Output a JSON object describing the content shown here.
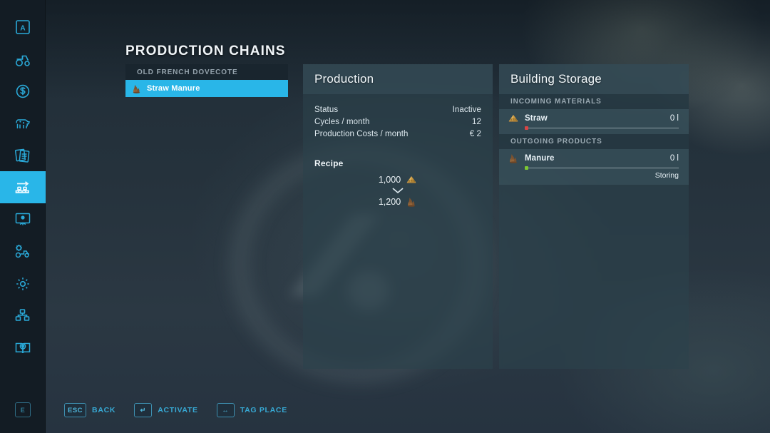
{
  "page": {
    "title": "PRODUCTION CHAINS"
  },
  "theme": {
    "accent": "#29b6e8",
    "panel_bg": "#2c424c",
    "text": "#eaf2f7",
    "muted": "#95a3ad",
    "status_ok": "#7dc832",
    "status_err": "#d94545"
  },
  "sidebar": {
    "items": [
      {
        "icon": "key-a-icon",
        "name": "sidebar-item-key-a",
        "selected": false
      },
      {
        "icon": "tractor-icon",
        "name": "sidebar-item-vehicles",
        "selected": false
      },
      {
        "icon": "finances-icon",
        "name": "sidebar-item-finances",
        "selected": false
      },
      {
        "icon": "animals-icon",
        "name": "sidebar-item-animals",
        "selected": false
      },
      {
        "icon": "contracts-icon",
        "name": "sidebar-item-contracts",
        "selected": false
      },
      {
        "icon": "production-icon",
        "name": "sidebar-item-production-chains",
        "selected": true
      },
      {
        "icon": "ai-worker-icon",
        "name": "sidebar-item-ai-workers",
        "selected": false
      },
      {
        "icon": "construction-icon",
        "name": "sidebar-item-construction",
        "selected": false
      },
      {
        "icon": "gear-icon",
        "name": "sidebar-item-settings",
        "selected": false
      },
      {
        "icon": "map-overview-icon",
        "name": "sidebar-item-map-overview",
        "selected": false
      },
      {
        "icon": "help-book-icon",
        "name": "sidebar-item-help",
        "selected": false
      }
    ],
    "bottom_key": "E"
  },
  "production_list": {
    "group_header": "OLD FRENCH DOVECOTE",
    "items": [
      {
        "label": "Straw Manure",
        "icon": "manure-icon",
        "selected": true
      }
    ]
  },
  "production_panel": {
    "title": "Production",
    "stats": [
      {
        "label": "Status",
        "value": "Inactive"
      },
      {
        "label": "Cycles / month",
        "value": "12"
      },
      {
        "label": "Production Costs / month",
        "value": "€ 2"
      }
    ],
    "recipe": {
      "title": "Recipe",
      "input": {
        "amount": "1,000",
        "icon": "straw-icon"
      },
      "arrow": "⌄",
      "output": {
        "amount": "1,200",
        "icon": "manure-icon"
      }
    }
  },
  "storage_panel": {
    "title": "Building Storage",
    "sections": [
      {
        "header": "INCOMING MATERIALS",
        "rows": [
          {
            "name": "Straw",
            "icon": "straw-icon",
            "amount": "0 l",
            "fill_percent": 0,
            "dot_color": "#d94545",
            "status": ""
          }
        ]
      },
      {
        "header": "OUTGOING PRODUCTS",
        "rows": [
          {
            "name": "Manure",
            "icon": "manure-icon",
            "amount": "0 l",
            "fill_percent": 0,
            "dot_color": "#7dc832",
            "status": "Storing"
          }
        ]
      }
    ]
  },
  "hints": [
    {
      "key": "ESC",
      "glyph": "ESC",
      "label": "BACK"
    },
    {
      "key": "enter",
      "glyph": "↵",
      "label": "ACTIVATE"
    },
    {
      "key": "leftright",
      "glyph": "↔",
      "label": "TAG PLACE"
    }
  ]
}
